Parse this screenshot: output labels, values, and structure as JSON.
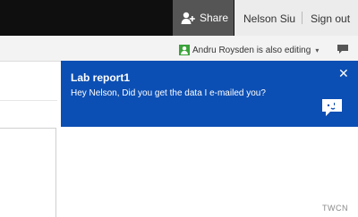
{
  "header": {
    "share_label": "Share",
    "user_name": "Nelson Siu",
    "signout_label": "Sign out"
  },
  "infobar": {
    "editing_text": "Andru Roysden is also editing",
    "caret": "▾"
  },
  "notification": {
    "title": "Lab report1",
    "message": "Hey Nelson, Did you get the data I e-mailed you?",
    "close_glyph": "✕"
  },
  "watermark": "TWCN",
  "colors": {
    "topbar": "#0f0f0f",
    "share_bg": "#555555",
    "notification_bg": "#0c4fb4",
    "coauthor_badge": "#3aa33a"
  },
  "icons": {
    "share": "add-person-icon",
    "coauthor": "person-badge-icon",
    "chat": "chat-bubble-icon",
    "close": "close-icon",
    "reply": "reply-chat-icon"
  }
}
